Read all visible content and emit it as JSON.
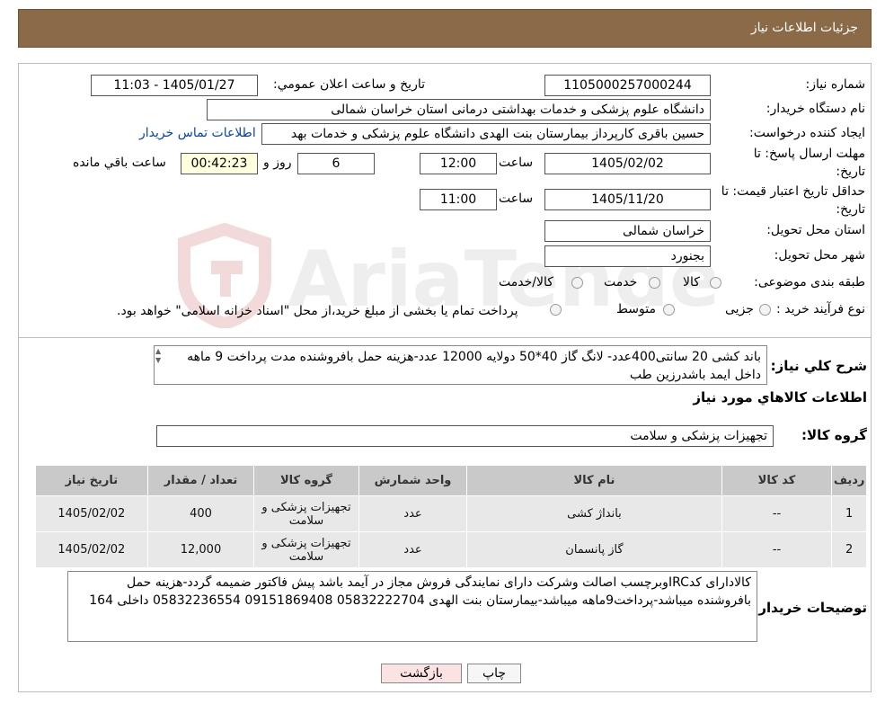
{
  "header": {
    "title": "جزئیات اطلاعات نیاز"
  },
  "form": {
    "need_number_label": "شماره نیاز:",
    "need_number": "1105000257000244",
    "announce_label": "تاریخ و ساعت اعلان عمومي:",
    "announce_value": "1405/01/27 - 11:03",
    "buyer_org_label": "نام دستگاه خريدار:",
    "buyer_org": "دانشگاه علوم پزشکی و خدمات بهداشتی درمانی استان خراسان شمالی",
    "requester_label": "ايجاد کننده درخواست:",
    "requester": "حسین باقری کارپرداز بیمارستان بنت الهدی دانشگاه علوم پزشکی و خدمات بهد",
    "contact_link": "اطلاعات تماس خریدار",
    "deadline_label_1": "مهلت ارسال پاسخ: تا",
    "deadline_label_2": "تاريخ:",
    "deadline_date": "1405/02/02",
    "time_word": "ساعت",
    "deadline_time": "12:00",
    "days_value": "6",
    "days_word": "روز و",
    "remaining_value": "00:42:23",
    "remaining_word": "ساعت باقي مانده",
    "validity_label_1": "حداقل تاريخ اعتبار قيمت: تا",
    "validity_label_2": "تاريخ:",
    "validity_date": "1405/11/20",
    "validity_time": "11:00",
    "province_label": "استان محل تحويل:",
    "province": "خراسان شمالی",
    "city_label": "شهر محل تحويل:",
    "city": "بجنورد",
    "category_label": "طبقه بندی موضوعی:",
    "category_options": [
      "کالا",
      "خدمت",
      "کالا/خدمت"
    ],
    "process_label": "نوع فرآيند خريد :",
    "process_options": [
      "جزیی",
      "متوسط"
    ],
    "process_note": "پرداخت تمام یا بخشی از مبلغ خرید،از محل \"اسناد خزانه اسلامی\" خواهد بود."
  },
  "description": {
    "label": "شرح کلي نياز:",
    "text": "باند کشی 20 سانتی400عدد- لانگ گاز 40*50 دولایه 12000 عدد-هزینه حمل بافروشنده مدت پرداخت 9 ماهه داخل ایمد باشدرزین طب"
  },
  "items_section": {
    "title": "اطلاعات کالاهاي مورد نياز",
    "group_label": "گروه کالا:",
    "group_value": "تجهیزات پزشکی و سلامت",
    "columns": [
      "رديف",
      "کد کالا",
      "نام کالا",
      "واحد شمارش",
      "گروه کالا",
      "تعداد / مقدار",
      "تاريخ نياز"
    ],
    "rows": [
      {
        "idx": "1",
        "code": "--",
        "name": "بانداژ کشی",
        "unit": "عدد",
        "group": "تجهیزات پزشکی و سلامت",
        "qty": "400",
        "date": "1405/02/02"
      },
      {
        "idx": "2",
        "code": "--",
        "name": "گاز پانسمان",
        "unit": "عدد",
        "group": "تجهیزات پزشکی و سلامت",
        "qty": "12,000",
        "date": "1405/02/02"
      }
    ]
  },
  "buyer_notes": {
    "label": "توضيحات خريدار:",
    "text": "کالادارای کدIRCوبرچسب اصالت وشرکت دارای نمایندگی فروش مجاز در آیمد باشد پیش فاکتور ضمیمه گردد-هزینه حمل بافروشنده میباشد-پرداخت9ماهه میباشد-بیمارستان بنت الهدی 05832222704 09151869408 05832236554 داخلی 164"
  },
  "buttons": {
    "print": "چاپ",
    "back": "بازگشت"
  },
  "watermark": "AriaTender.neT",
  "colors": {
    "header_bg": "#8b6a47",
    "link": "#0645ad",
    "remaining_bg": "#ffffdd",
    "back_btn_bg": "#fbe3e3"
  }
}
